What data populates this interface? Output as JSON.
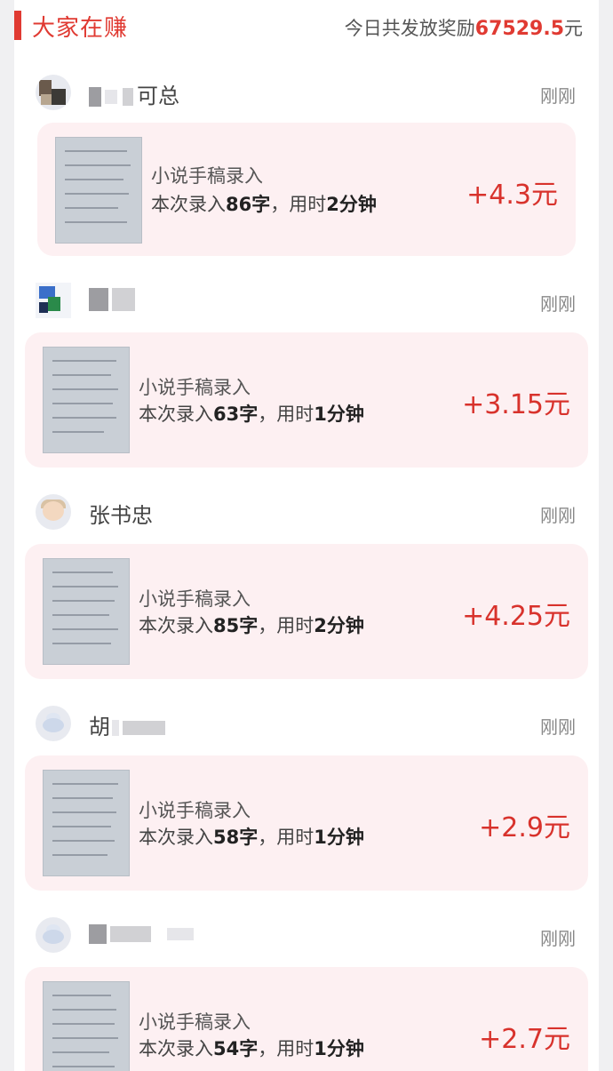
{
  "header": {
    "title": "大家在赚",
    "summary_prefix": "今日共发放奖励",
    "summary_amount": "67529.5",
    "summary_unit": "元"
  },
  "colors": {
    "accent": "#e03a32",
    "card_bg": "#fdf0f2",
    "reward": "#d8322c"
  },
  "items": [
    {
      "username": "可总",
      "time": "刚刚",
      "task_title": "小说手稿录入",
      "detail_prefix": "本次录入",
      "chars": "86字",
      "detail_mid": "，用时",
      "duration": "2分钟",
      "reward": "+4.3元"
    },
    {
      "username": "",
      "time": "刚刚",
      "task_title": "小说手稿录入",
      "detail_prefix": "本次录入",
      "chars": "63字",
      "detail_mid": "，用时",
      "duration": "1分钟",
      "reward": "+3.15元"
    },
    {
      "username": "张书忠",
      "time": "刚刚",
      "task_title": "小说手稿录入",
      "detail_prefix": "本次录入",
      "chars": "85字",
      "detail_mid": "，用时",
      "duration": "2分钟",
      "reward": "+4.25元"
    },
    {
      "username": "胡",
      "time": "刚刚",
      "task_title": "小说手稿录入",
      "detail_prefix": "本次录入",
      "chars": "58字",
      "detail_mid": "，用时",
      "duration": "1分钟",
      "reward": "+2.9元"
    },
    {
      "username": "",
      "time": "刚刚",
      "task_title": "小说手稿录入",
      "detail_prefix": "本次录入",
      "chars": "54字",
      "detail_mid": "，用时",
      "duration": "1分钟",
      "reward": "+2.7元"
    }
  ]
}
